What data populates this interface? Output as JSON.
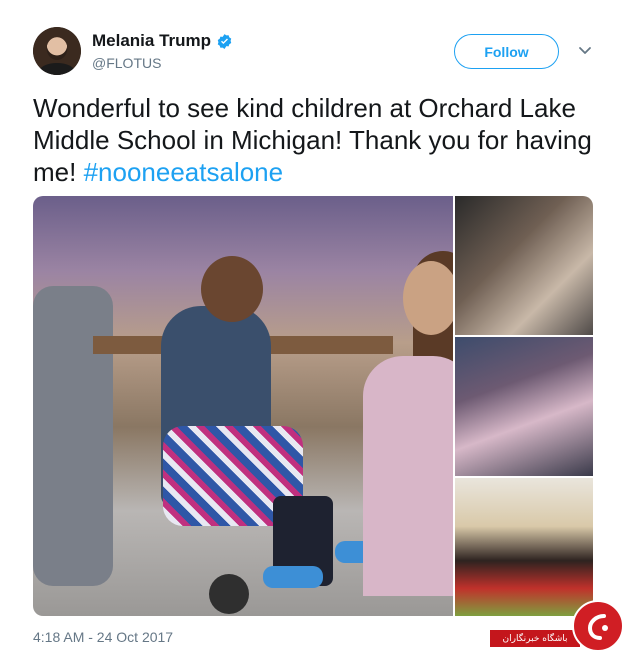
{
  "user": {
    "display_name": "Melania Trump",
    "handle": "@FLOTUS",
    "verified": true
  },
  "follow_button": {
    "label": "Follow"
  },
  "tweet": {
    "text_before_hashtag": "Wonderful to see kind children at Orchard Lake Middle School in Michigan! Thank you for having me! ",
    "hashtag": "#nooneeatsalone",
    "timestamp": "4:18 AM - 24 Oct 2017"
  },
  "icons": {
    "verified": "verified-badge-icon",
    "caret": "chevron-down-icon"
  },
  "watermark": {
    "text": "باشگاه خبرنگاران"
  },
  "colors": {
    "accent": "#1da1f2",
    "text": "#14171a",
    "muted": "#657786",
    "watermark_red": "#c4161c"
  }
}
